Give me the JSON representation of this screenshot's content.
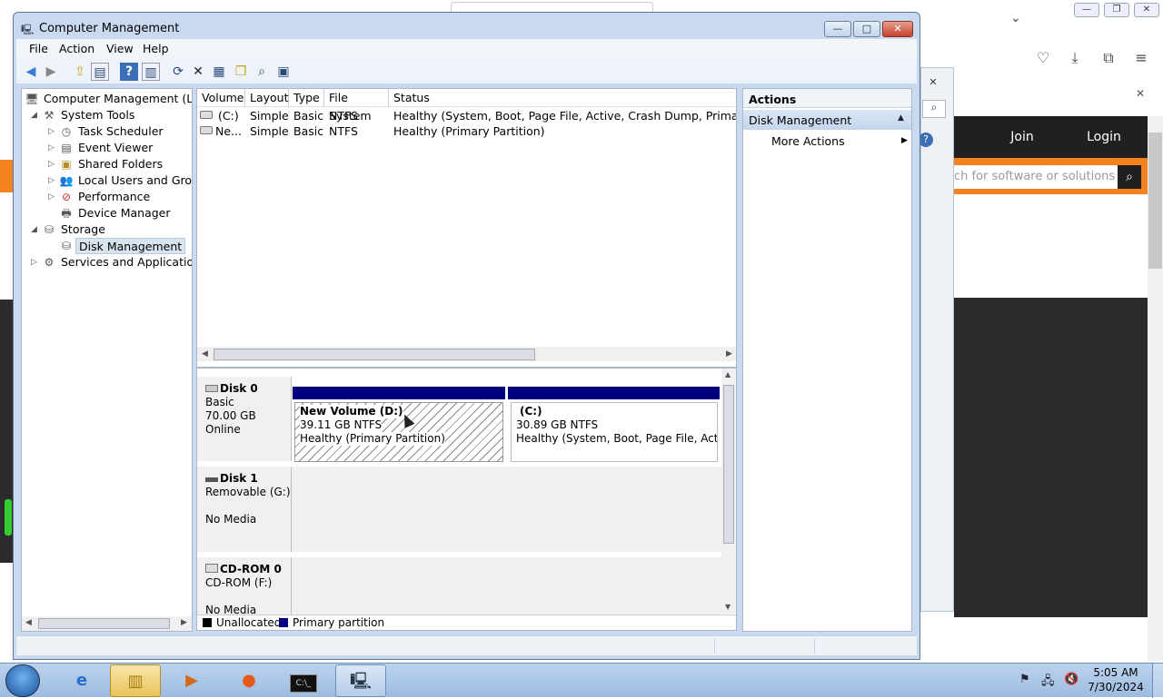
{
  "window": {
    "title": "Computer Management",
    "controls": {
      "minimize": "—",
      "maximize": "□",
      "close": "✕"
    }
  },
  "menu": [
    "File",
    "Action",
    "View",
    "Help"
  ],
  "tree": {
    "root": "Computer Management (Local",
    "system_tools": "System Tools",
    "task_scheduler": "Task Scheduler",
    "event_viewer": "Event Viewer",
    "shared_folders": "Shared Folders",
    "local_users": "Local Users and Groups",
    "performance": "Performance",
    "device_manager": "Device Manager",
    "storage": "Storage",
    "disk_management": "Disk Management",
    "services": "Services and Applications"
  },
  "volumes": {
    "columns": [
      "Volume",
      "Layout",
      "Type",
      "File System",
      "Status"
    ],
    "rows": [
      {
        "volume": "(C:)",
        "layout": "Simple",
        "type": "Basic",
        "fs": "NTFS",
        "status": "Healthy (System, Boot, Page File, Active, Crash Dump, Primary Partition"
      },
      {
        "volume": "Ne...",
        "layout": "Simple",
        "type": "Basic",
        "fs": "NTFS",
        "status": "Healthy (Primary Partition)"
      }
    ]
  },
  "disks": {
    "disk0": {
      "name": "Disk 0",
      "type": "Basic",
      "size": "70.00 GB",
      "state": "Online"
    },
    "disk1": {
      "name": "Disk 1",
      "type": "Removable (G:)",
      "state": "No Media"
    },
    "cdrom": {
      "name": "CD-ROM 0",
      "type": "CD-ROM (F:)",
      "state": "No Media"
    },
    "partD": {
      "title": "New Volume  (D:)",
      "size": "39.11 GB NTFS",
      "status": "Healthy (Primary Partition)"
    },
    "partC": {
      "title": "(C:)",
      "size": "30.89 GB NTFS",
      "status": "Healthy (System, Boot, Page File, Active, C"
    }
  },
  "legend": {
    "unallocated": "Unallocated",
    "primary": "Primary partition"
  },
  "actions": {
    "header": "Actions",
    "section": "Disk Management",
    "more": "More Actions"
  },
  "browser": {
    "search_placeholder": "ch for software or solutions",
    "join": "Join",
    "login": "Login"
  },
  "taskbar": {
    "time": "5:05 AM",
    "date": "7/30/2024"
  },
  "colors": {
    "primary_partition": "#00007f",
    "unallocated": "#000000",
    "accent": "#f58220"
  }
}
